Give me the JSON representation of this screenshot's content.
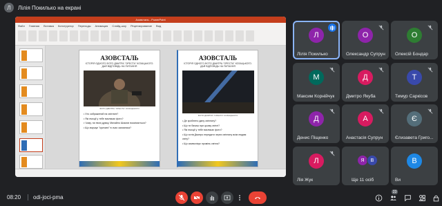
{
  "header": {
    "presenter_initial": "Л",
    "presenter_text": "Лілія Покилько на екрані"
  },
  "ppt": {
    "window_title": "Азовсталь - PowerPoint",
    "tabs": [
      "Файл",
      "Главная",
      "Вставка",
      "Конструктор",
      "Переходы",
      "Анимация",
      "Слайд-шоу",
      "Рецензирование",
      "Вид"
    ],
    "slide_left": {
      "heading": "АЗОВСТАЛЬ",
      "sub": "ІСТОРІЯ ОДНОГО ФОТО ДМИТРА \"ОРЕСТА\" КОЗАЦЬКОГО. ДАЙ ВІДПОВІДЬ НА ПИТАННЯ",
      "caption": "ФОТО ДМИТРА \"ОРЕСТА\" КОЗАЦЬКОГО",
      "questions": [
        "Хто зображений на світлині?",
        "Які емоції у тебе викликає фото?",
        "Чому, на твою думку, Михайло Шамов посміхається?",
        "Що змушує \"кричати\" в очах захисника?"
      ]
    },
    "slide_right": {
      "heading": "АЗОВСТАЛЬ",
      "sub": "ІСТОРІЯ ОДНОГО ФОТО ДМИТРА \"ОРЕСТА\" КОЗАЦЬКОГО. ДАЙ ВІДПОВІДЬ НА ПИТАННЯ",
      "caption": "ФОТО ДМИТРА \"ОРЕСТА\" КОЗАЦЬКОГО",
      "questions": [
        "Де зроблено дану світлину?",
        "Що ти бачиш при цьому світлі?",
        "Які емоції у тебе викликає фото?",
        "Що хотів Дмитро передати через світлину всім людям світу?",
        "Що символізує промінь світла?"
      ]
    }
  },
  "participants": [
    {
      "initial": "Л",
      "name": "Лілія Покилько",
      "color": "#8e24aa",
      "speaking": true
    },
    {
      "initial": "О",
      "name": "Олександр Супрун",
      "color": "#8e24aa",
      "muted": true
    },
    {
      "initial": "О",
      "name": "Олексій Бондар",
      "color": "#2e7d32",
      "muted": true
    },
    {
      "initial": "М",
      "name": "Максим Корнійчук",
      "color": "#00695c",
      "muted": true
    },
    {
      "initial": "Д",
      "name": "Дмитро Якуба",
      "color": "#d81b60",
      "muted": true
    },
    {
      "initial": "Т",
      "name": "Тимур Саркісов",
      "color": "#3949ab",
      "muted": true
    },
    {
      "initial": "Д",
      "name": "Денис Піщенко",
      "color": "#8e24aa",
      "muted": true
    },
    {
      "initial": "А",
      "name": "Анастасія Супрун",
      "color": "#d81b60",
      "muted": true
    },
    {
      "initial": "Є",
      "name": "Єлизавета Григо...",
      "color": "#546e7a",
      "muted": true
    },
    {
      "initial": "Л",
      "name": "Лія Жук",
      "color": "#d81b60",
      "muted": true
    },
    {
      "initial": "",
      "name": "Ще 11 осіб",
      "color": "#3c4043",
      "stack": [
        "Я",
        "В"
      ]
    },
    {
      "initial": "В",
      "name": "Ви",
      "color": "#1e88e5",
      "muted": false
    }
  ],
  "bottom": {
    "time": "08:20",
    "meeting_code": "odi-joci-pma",
    "people_count": "23"
  }
}
